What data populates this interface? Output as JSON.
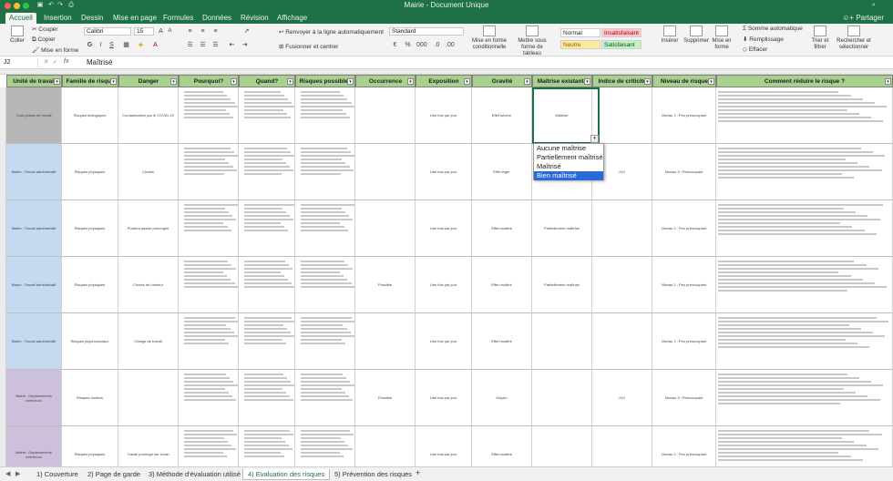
{
  "window": {
    "title": "Mairie - Document Unique",
    "quick_access": [
      "save-icon",
      "undo-icon",
      "redo-icon",
      "print-icon"
    ]
  },
  "ribbon_tabs": [
    "Accueil",
    "Insertion",
    "Dessin",
    "Mise en page",
    "Formules",
    "Données",
    "Révision",
    "Affichage"
  ],
  "active_tab": "Accueil",
  "share_label": "Partager",
  "ribbon": {
    "paste_label": "Coller",
    "cut_label": "Couper",
    "copy_label": "Copier",
    "format_label": "Mise en forme",
    "font_name": "Calibri",
    "font_size": "15",
    "bold": "G",
    "italic": "I",
    "underline": "S",
    "wrap_label": "Renvoyer à la ligne automatiquement",
    "merge_label": "Fusionner et centrer",
    "number_format": "Standard",
    "cond_format_label": "Mise en forme conditionnelle",
    "table_format_label": "Mettre sous forme de tableau",
    "styles": [
      {
        "label": "Normal",
        "bg": "#ffffff",
        "fg": "#222222"
      },
      {
        "label": "Insatisfaisant",
        "bg": "#ffc7ce",
        "fg": "#9c0006"
      },
      {
        "label": "Neutre",
        "bg": "#ffeb9c",
        "fg": "#9c5700"
      },
      {
        "label": "Satisfaisant",
        "bg": "#c6efce",
        "fg": "#006100"
      }
    ],
    "insert_label": "Insérer",
    "delete_label": "Supprimer",
    "format_cells_label": "Mise en forme",
    "autosum_label": "Somme automatique",
    "fill_label": "Remplissage",
    "clear_label": "Effacer",
    "sort_label": "Trier et filtrer",
    "find_label": "Rechercher et sélectionner"
  },
  "formula_bar": {
    "cell_ref": "J2",
    "fx": "fx",
    "content": "Maîtrisé"
  },
  "headers": [
    "Unité de travail",
    "Famille de risque",
    "Danger",
    "Pourquoi?",
    "Quand?",
    "Risques possibles",
    "Occurrence",
    "Exposition",
    "Gravité",
    "Maîtrise existante",
    "Indice de criticité",
    "Niveau de risque",
    "Comment réduire le risque ?"
  ],
  "rows": [
    {
      "unit": "Tous postes de travail",
      "family": "Risques biologiques",
      "danger": "Contamination par le COVID-19",
      "exposure": "Une fois par jour",
      "gravity": "Effet sévère",
      "control": "Maîtrisé",
      "level": "Niveau 2 : Peu préoccupant",
      "unit_color": "#b7b7b7"
    },
    {
      "unit": "Mairie : Travail administratif",
      "family": "Risques physiques",
      "danger": "Chutes",
      "exposure": "Une fois par jour",
      "gravity": "Effet léger",
      "control": "",
      "index": "2x3",
      "level": "Niveau 3 : Préoccupant",
      "unit_color": "#c5d9f1"
    },
    {
      "unit": "Mairie : Travail administratif",
      "family": "Risques physiques",
      "danger": "Position assise prolongée",
      "exposure": "Une fois par jour",
      "gravity": "Effet modéré",
      "control": "Partiellement maîtrisé",
      "level": "Niveau 2 : Peu préoccupant",
      "unit_color": "#c5d9f1"
    },
    {
      "unit": "Mairie : Travail administratif",
      "family": "Risques physiques",
      "danger": "Chutes de hauteur",
      "occurrence": "Possible",
      "exposure": "Une fois par jour",
      "gravity": "Effet modéré",
      "control": "Partiellement maîtrisé",
      "level": "Niveau 2 : Peu préoccupant",
      "unit_color": "#c5d9f1"
    },
    {
      "unit": "Mairie : Travail administratif",
      "family": "Risques psychosociaux",
      "danger": "Charge de travail",
      "exposure": "Une fois par jour",
      "gravity": "Effet modéré",
      "control": "",
      "level": "Niveau 2 : Peu préoccupant",
      "unit_color": "#c5d9f1"
    },
    {
      "unit": "Mairie : Déplacements extérieurs",
      "family": "Risques routiers",
      "danger": "",
      "occurrence": "Possible",
      "exposure": "Une fois par jour",
      "gravity": "Moyen",
      "control": "",
      "index": "2x3",
      "level": "Niveau 3 : Préoccupant",
      "unit_color": "#ccc0da"
    },
    {
      "unit": "Mairie : Déplacements extérieurs",
      "family": "Risques physiques",
      "danger": "Travail prolongé sur écran",
      "exposure": "Une fois par jour",
      "gravity": "Effet modéré",
      "control": "",
      "level": "Niveau 2 : Peu préoccupant",
      "unit_color": "#ccc0da"
    }
  ],
  "dropdown": {
    "options": [
      "Aucune maîtrise",
      "Partiellement maîtrisé",
      "Maîtrisé",
      "Bien maîtrisé"
    ],
    "selected_index": 3
  },
  "sheet_tabs": [
    "1) Couverture",
    "2) Page de garde",
    "3) Méthode d'évaluation utilisé",
    "4) Evaluation des risques",
    "5) Prévention des risques"
  ],
  "active_sheet": "4) Evaluation des risques"
}
